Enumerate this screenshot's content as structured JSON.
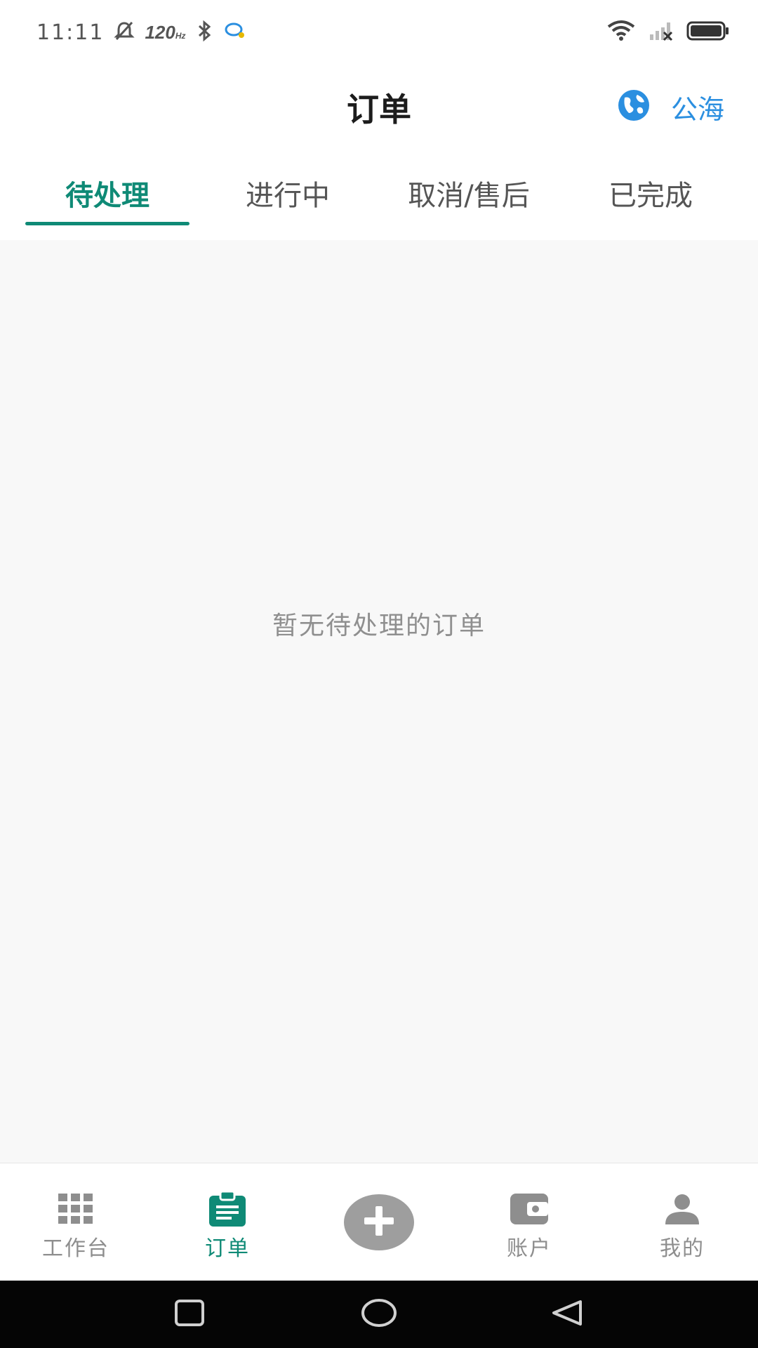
{
  "status_bar": {
    "time": "11:11",
    "refresh_rate": "120",
    "refresh_unit": "Hz"
  },
  "header": {
    "title": "订单",
    "sea_label": "公海"
  },
  "tabs": [
    {
      "label": "待处理",
      "active": true
    },
    {
      "label": "进行中",
      "active": false
    },
    {
      "label": "取消/售后",
      "active": false
    },
    {
      "label": "已完成",
      "active": false
    }
  ],
  "content": {
    "empty_message": "暂无待处理的订单"
  },
  "bottom_nav": {
    "items": [
      {
        "label": "工作台",
        "icon": "grid-icon"
      },
      {
        "label": "订单",
        "icon": "clipboard-icon",
        "active": true
      },
      {
        "label": "",
        "icon": "plus-icon"
      },
      {
        "label": "账户",
        "icon": "wallet-icon"
      },
      {
        "label": "我的",
        "icon": "person-icon"
      }
    ]
  },
  "colors": {
    "accent": "#0f8a76",
    "link": "#2b8fe0",
    "background": "#f8f8f8",
    "nav_inactive": "#8e8e8e"
  }
}
